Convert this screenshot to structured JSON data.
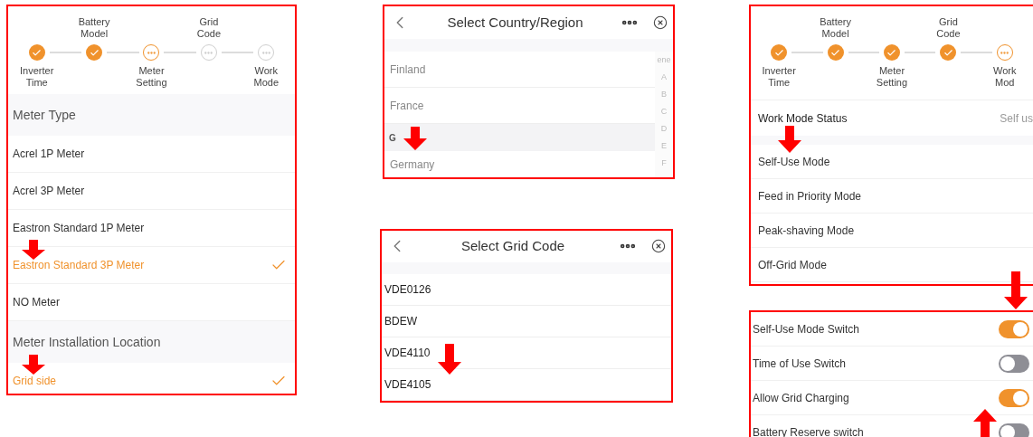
{
  "meter_setting": {
    "steps": [
      {
        "label": "Inverter Time",
        "kind": "done"
      },
      {
        "label": "Battery Model",
        "kind": "done"
      },
      {
        "label": "Meter Setting",
        "kind": "current"
      },
      {
        "label": "Grid Code",
        "kind": "pending"
      },
      {
        "label": "Work Mode",
        "kind": "pending"
      }
    ],
    "sections": [
      {
        "title": "Meter Type",
        "options": [
          {
            "label": "Acrel 1P Meter",
            "selected": false
          },
          {
            "label": "Acrel 3P Meter",
            "selected": false
          },
          {
            "label": "Eastron Standard 1P Meter",
            "selected": false
          },
          {
            "label": "Eastron Standard 3P Meter",
            "selected": true
          },
          {
            "label": "NO Meter",
            "selected": false
          }
        ]
      },
      {
        "title": "Meter Installation Location",
        "options": [
          {
            "label": "Grid side",
            "selected": true
          }
        ]
      }
    ]
  },
  "country_select": {
    "title": "Select Country/Region",
    "groups": [
      {
        "items": [
          "Finland",
          "France"
        ]
      },
      {
        "header": "G",
        "items": [
          "Germany"
        ]
      }
    ],
    "index": [
      "ene",
      "A",
      "B",
      "C",
      "D",
      "E",
      "F"
    ]
  },
  "grid_code_select": {
    "title": "Select Grid Code",
    "items": [
      "VDE0126",
      "BDEW",
      "VDE4110",
      "VDE4105"
    ]
  },
  "work_mode": {
    "steps": [
      {
        "label": "Inverter Time",
        "kind": "done"
      },
      {
        "label": "Battery Model",
        "kind": "done"
      },
      {
        "label": "Meter Setting",
        "kind": "done"
      },
      {
        "label": "Grid Code",
        "kind": "done"
      },
      {
        "label": "Work Mod",
        "kind": "current"
      }
    ],
    "status": {
      "label": "Work Mode Status",
      "value": "Self us"
    },
    "modes": [
      "Self-Use Mode",
      "Feed in Priority Mode",
      "Peak-shaving Mode",
      "Off-Grid Mode"
    ]
  },
  "switches": [
    {
      "label": "Self-Use Mode Switch",
      "on": true
    },
    {
      "label": "Time of Use Switch",
      "on": false
    },
    {
      "label": "Allow Grid Charging",
      "on": true
    },
    {
      "label": "Battery Reserve switch",
      "on": false
    }
  ]
}
